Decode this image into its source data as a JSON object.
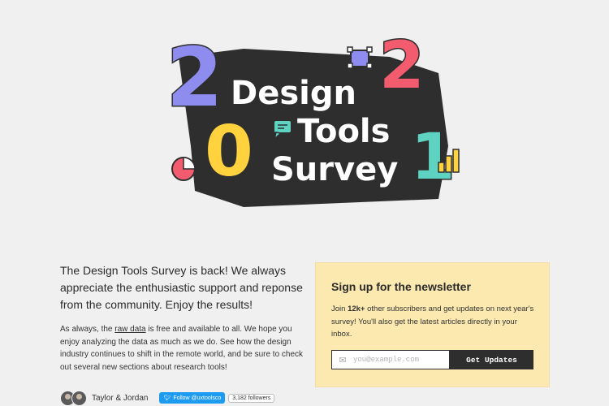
{
  "hero": {
    "words": [
      "Design",
      "Tools",
      "Survey"
    ],
    "digits": [
      "2",
      "0",
      "2",
      "1"
    ],
    "colors": {
      "dark": "#2e2e2e",
      "purple": "#8f8cf0",
      "red": "#f25c6e",
      "yellow": "#ffd23e",
      "teal": "#5fd3c2"
    }
  },
  "intro": {
    "lead": "The Design Tools Survey is back! We always appreciate the enthusiastic support and reponse from the community. Enjoy the results!",
    "body_before_link": "As always, the ",
    "body_link": "raw data",
    "body_after_link": " is free and available to all. We hope you enjoy analyzing the data as much as we do. See how the design industry continues to shift in the remote world, and be sure to check out several new sections about research tools!"
  },
  "authors": {
    "names": "Taylor & Jordan",
    "follow_label": "Follow @uxtoolsco",
    "followers": "3,182 followers"
  },
  "newsletter": {
    "title": "Sign up for the newsletter",
    "desc_before_bold": "Join ",
    "desc_bold": "12k+",
    "desc_after_bold": " other subscribers and get updates on next year's survey! You'll also get the latest articles directly in your inbox.",
    "input_placeholder": "you@example.com",
    "button_label": "Get Updates",
    "background": "#fbe9b0"
  },
  "icons": {
    "mail": "mail-icon",
    "twitter": "twitter-bird-icon",
    "chat": "chat-bubble-icon",
    "selection": "selection-box-icon",
    "pie": "pie-chart-icon",
    "bars": "bar-chart-icon"
  }
}
